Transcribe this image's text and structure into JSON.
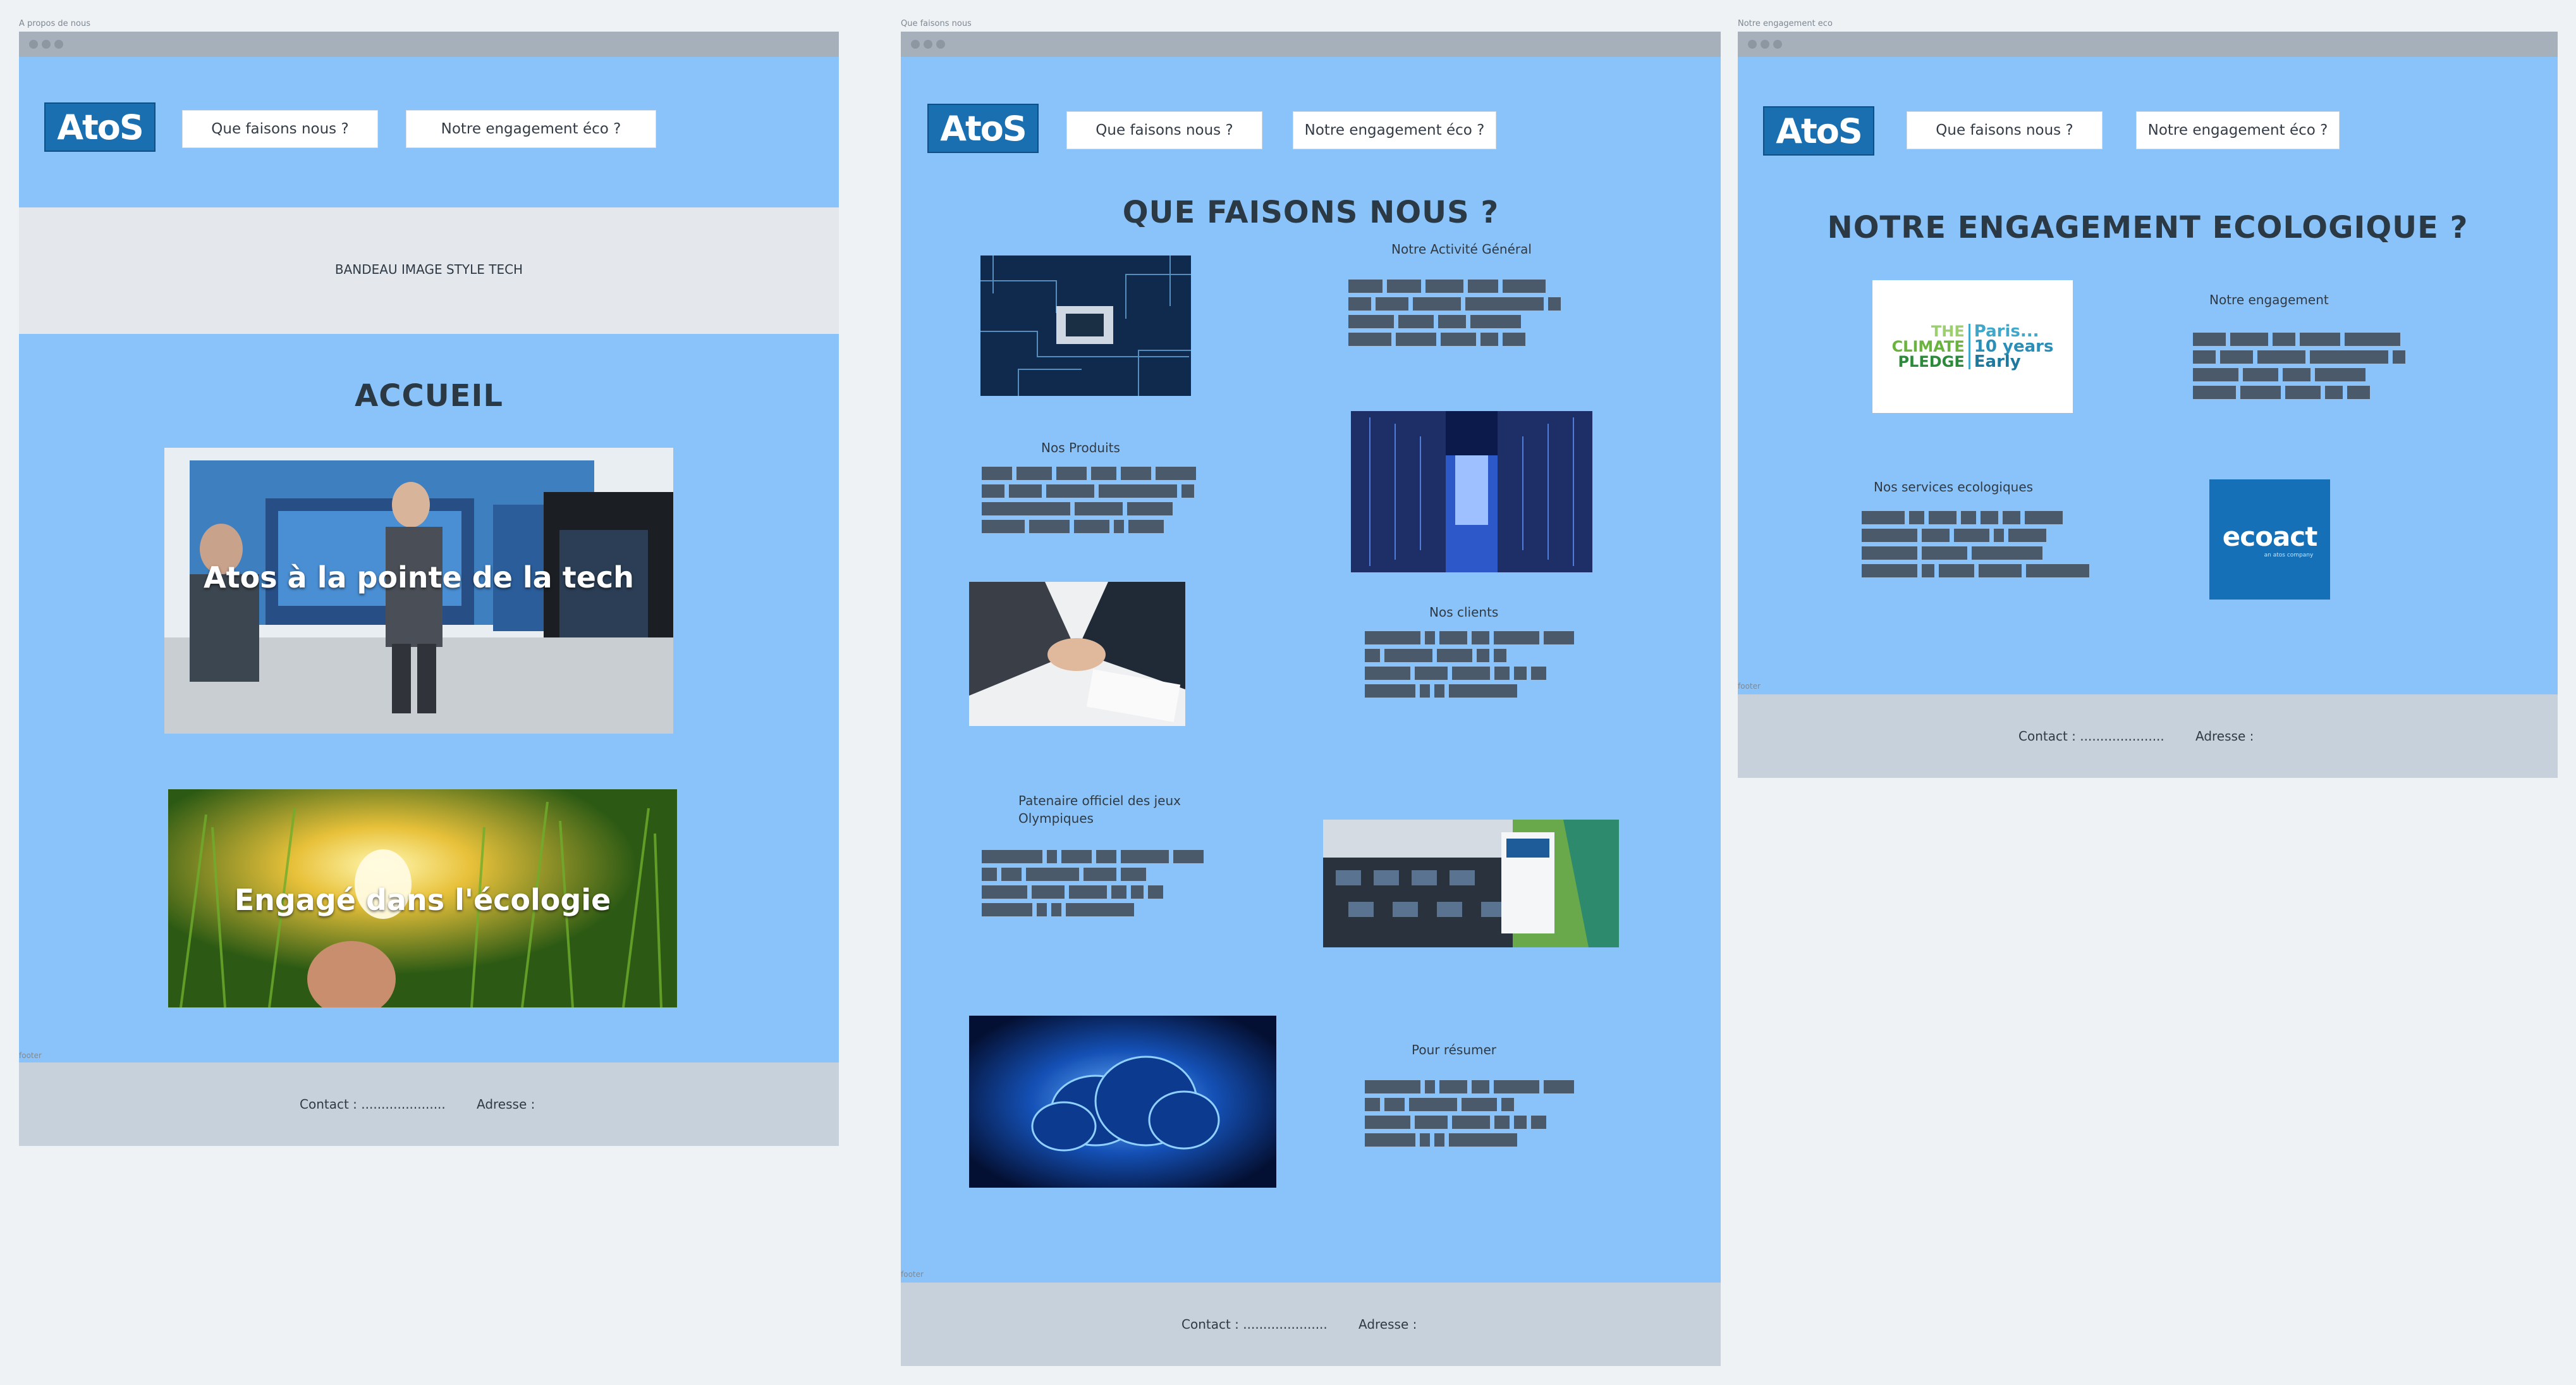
{
  "frames": {
    "about": {
      "label": "A propos de nous"
    },
    "what": {
      "label": "Que faisons nous"
    },
    "eco": {
      "label": "Notre engagement eco"
    }
  },
  "nav": {
    "logo": "AtoS",
    "what_button": "Que faisons nous ?",
    "eco_button": "Notre engagement éco ?"
  },
  "about_page": {
    "banner": "BANDEAU IMAGE STYLE TECH",
    "title": "ACCUEIL",
    "hero1_caption": "Atos à la pointe de la tech",
    "hero2_caption": "Engagé dans l'écologie"
  },
  "what_page": {
    "title": "QUE FAISONS NOUS ?",
    "section_general": "Notre Activité Général",
    "section_products": "Nos Produits",
    "section_clients": "Nos clients",
    "section_olympics": "Patenaire officiel des jeux Olympiques",
    "section_summary": "Pour résumer"
  },
  "eco_page": {
    "title": "NOTRE ENGAGEMENT ECOLOGIQUE ?",
    "section_commitment": "Notre engagement",
    "section_services": "Nos services ecologiques",
    "pledge_logo": {
      "the": "THE",
      "climate": "CLIMATE",
      "pledge": "PLEDGE",
      "paris": "Paris...",
      "years": "10 years",
      "early": "Early"
    },
    "ecoact_logo": "ecoact",
    "ecoact_sub": "an atos company"
  },
  "footer": {
    "tag": "footer",
    "contact": "Contact : .....................",
    "address": "Adresse :"
  },
  "colors": {
    "page_bg": "#8ac3f9",
    "footer_bg": "#c6d1db",
    "banner_bg": "#e4e8ec",
    "logo_bg": "#1a6fb0",
    "placeholder": "#4b5a6a"
  }
}
